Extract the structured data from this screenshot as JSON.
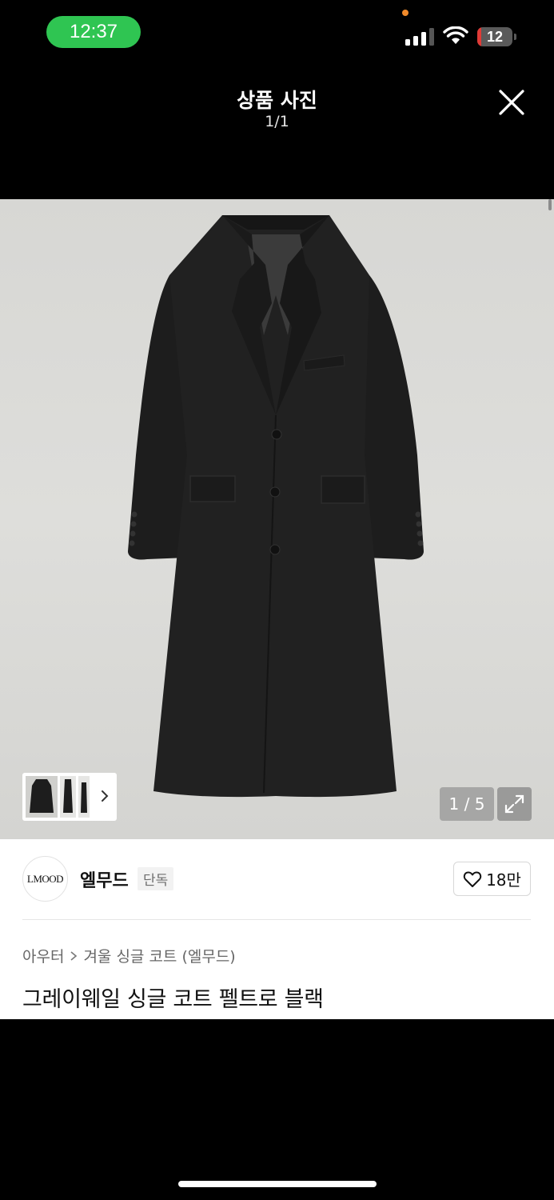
{
  "status_bar": {
    "time": "12:37",
    "battery_level": "12",
    "battery_fraction": 0.12,
    "colors": {
      "time_pill": "#2fc552",
      "battery_low": "#e03a36",
      "privacy_dot": "#f08a2a"
    }
  },
  "header": {
    "title": "상품 사진",
    "count": "1/1",
    "close_icon": "close-icon"
  },
  "gallery": {
    "image_subject": "black-single-coat",
    "page_indicator": "1 / 5",
    "thumbnails": [
      "coat-front",
      "coat-side",
      "coat-back"
    ],
    "expand_icon": "expand-icon",
    "next_icon": "chevron-right-icon"
  },
  "brand": {
    "logo_text": "LMOOD",
    "name": "엘무드",
    "badge": "단독"
  },
  "like": {
    "icon": "heart-icon",
    "count": "18만"
  },
  "breadcrumb": [
    "아우터",
    "겨울 싱글 코트 (엘무드)"
  ],
  "product": {
    "title": "그레이웨일 싱글 코트 펠트로 블랙"
  }
}
